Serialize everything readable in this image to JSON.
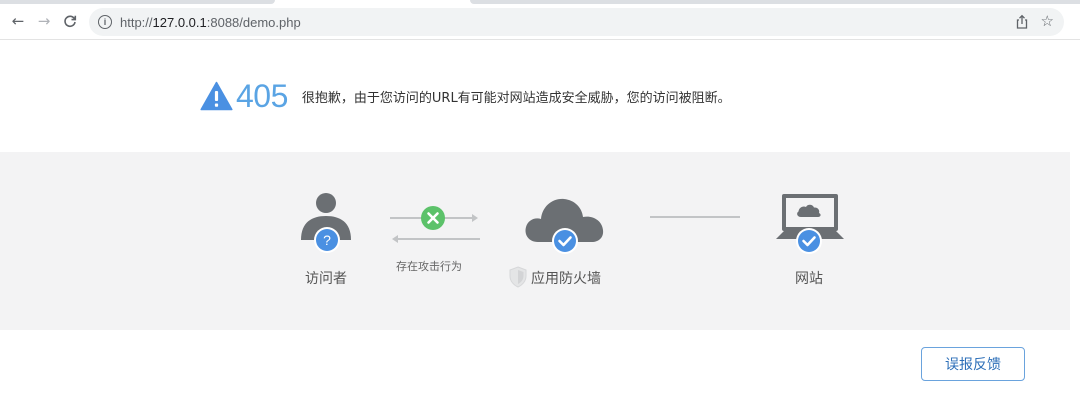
{
  "browser": {
    "url_scheme": "http://",
    "url_host": "127.0.0.1",
    "url_rest": ":8088/demo.php"
  },
  "message": {
    "code": "405",
    "text": "很抱歉，由于您访问的URL有可能对网站造成安全威胁，您的访问被阻断。"
  },
  "diagram": {
    "visitor_label": "访问者",
    "attack_label": "存在攻击行为",
    "firewall_label": "应用防火墙",
    "website_label": "网站"
  },
  "actions": {
    "feedback_label": "误报反馈"
  },
  "colors": {
    "accent_blue": "#4a90e2",
    "code_blue": "#5aa4e4",
    "block_green": "#5cc26a",
    "icon_gray": "#6b6f73",
    "band_bg": "#f3f3f4"
  }
}
